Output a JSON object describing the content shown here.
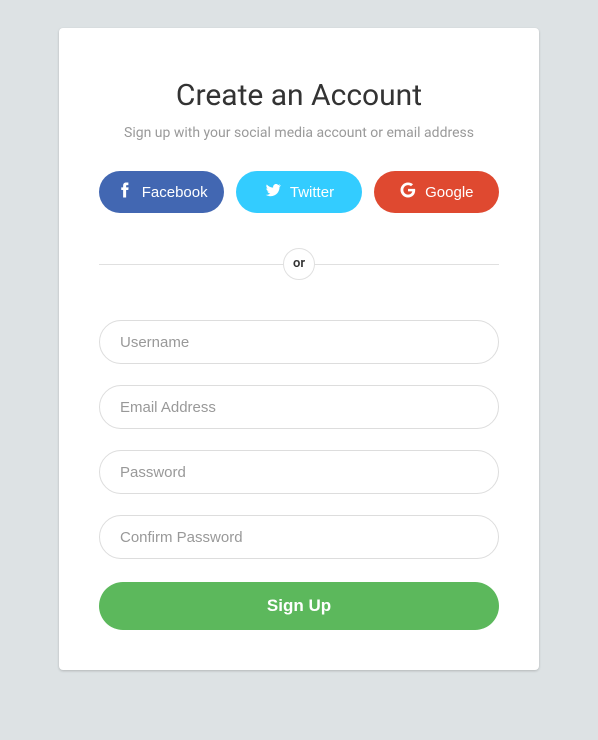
{
  "header": {
    "title": "Create an Account",
    "subtitle": "Sign up with your social media account or email address"
  },
  "social": {
    "facebook": "Facebook",
    "twitter": "Twitter",
    "google": "Google"
  },
  "divider": "or",
  "form": {
    "username_placeholder": "Username",
    "email_placeholder": "Email Address",
    "password_placeholder": "Password",
    "confirm_placeholder": "Confirm Password",
    "submit_label": "Sign Up"
  }
}
